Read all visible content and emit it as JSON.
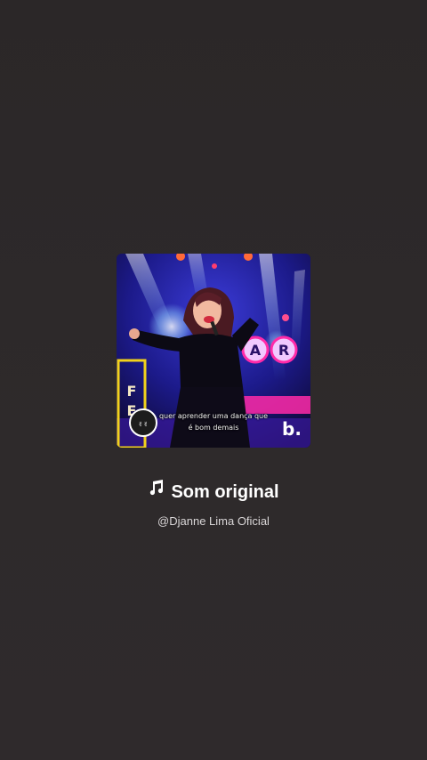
{
  "cover": {
    "caption_line1": "quer aprender uma dança que",
    "caption_line2": "é bom demais",
    "sign_letters": "AR",
    "side_letters": "F E",
    "watermark": "b."
  },
  "sound": {
    "icon": "music-note-icon",
    "title": "Som original",
    "artist": "@Djanne Lima Oficial"
  },
  "colors": {
    "background": "#2c2829",
    "title": "#ffffff",
    "artist": "#d9d6d7"
  }
}
